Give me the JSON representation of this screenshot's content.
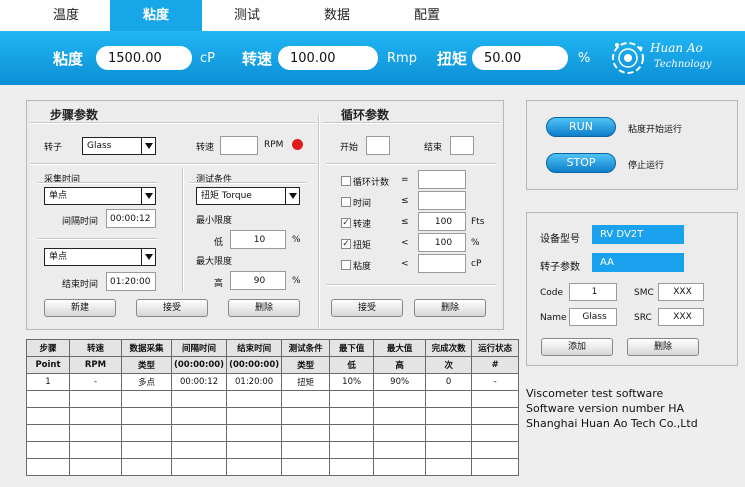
{
  "tabs": [
    {
      "label": "温度",
      "active": false
    },
    {
      "label": "粘度",
      "active": true
    },
    {
      "label": "测试",
      "active": false
    },
    {
      "label": "数据",
      "active": false
    },
    {
      "label": "配置",
      "active": false
    }
  ],
  "header": {
    "viscosity_label": "粘度",
    "viscosity_value": "1500.00",
    "viscosity_unit": "cP",
    "speed_label": "转速",
    "speed_value": "100.00",
    "speed_unit": "Rmp",
    "torque_label": "扭矩",
    "torque_value": "50.00",
    "torque_unit": "%",
    "logo_line1": "Huan Ao",
    "logo_line2": "Technology"
  },
  "step": {
    "title": "步骤参数",
    "rotor_label": "转子",
    "rotor_value": "Glass",
    "speed_label": "转速",
    "speed_value": "",
    "speed_unit": "RPM",
    "sampling_title": "采集时间",
    "sampling_mode_1": "单点",
    "interval_label": "间隔时间",
    "interval_value": "00:00:12",
    "sampling_mode_2": "单点",
    "end_label": "结束时间",
    "end_value": "01:20:00",
    "test_condition_label": "测试条件",
    "test_condition_value": "扭矩  Torque",
    "min_limit_label": "最小限度",
    "min_low_label": "低",
    "min_value": "10",
    "min_unit": "%",
    "max_limit_label": "最大限度",
    "max_high_label": "高",
    "max_value": "90",
    "max_unit": "%",
    "new_btn": "新建",
    "accept_btn": "接受",
    "delete_btn": "删除"
  },
  "loop": {
    "title": "循环参数",
    "start_label": "开始",
    "start_value": "",
    "end_label": "结束",
    "end_value": "",
    "rows": [
      {
        "label": "循环计数",
        "checked": false,
        "op": "=",
        "value": "",
        "unit": ""
      },
      {
        "label": "时间",
        "checked": false,
        "op": "≤",
        "value": "",
        "unit": ""
      },
      {
        "label": "转速",
        "checked": true,
        "op": "≤",
        "value": "100",
        "unit": "Fts"
      },
      {
        "label": "扭矩",
        "checked": true,
        "op": "<",
        "value": "100",
        "unit": "%"
      },
      {
        "label": "粘度",
        "checked": false,
        "op": "<",
        "value": "",
        "unit": "cP"
      }
    ],
    "accept_btn": "接受",
    "delete_btn": "删除"
  },
  "run": {
    "run_btn": "RUN",
    "run_desc": "粘度开始运行",
    "stop_btn": "STOP",
    "stop_desc": "停止运行"
  },
  "device": {
    "model_label": "设备型号",
    "model_value": "RV DV2T",
    "rotor_param_label": "转子参数",
    "rotor_param_value": "AA",
    "code_label": "Code",
    "code_value": "1",
    "smc_label": "SMC",
    "smc_value": "XXX",
    "name_label": "Name",
    "name_value": "Glass",
    "src_label": "SRC",
    "src_value": "XXX",
    "add_btn": "添加",
    "delete_btn": "删除"
  },
  "table": {
    "header1": [
      "步骤",
      "转速",
      "数据采集",
      "间隔时间",
      "结束时间",
      "测试条件",
      "最下值",
      "最大值",
      "完成次数",
      "运行状态"
    ],
    "header2": [
      "Point",
      "RPM",
      "类型",
      "(00:00:00)",
      "(00:00:00)",
      "类型",
      "低",
      "高",
      "次",
      "#"
    ],
    "rows": [
      [
        "1",
        "-",
        "多点",
        "00:00:12",
        "01:20:00",
        "扭矩",
        "10%",
        "90%",
        "0",
        "-"
      ]
    ],
    "empty_rows": 5
  },
  "info": {
    "line1": "Viscometer test software",
    "line2": "Software version number HA",
    "line3": "Shanghai Huan Ao Tech Co.,Ltd"
  },
  "colors": {
    "accent": "#17a6e8",
    "status_dot": "#e11c1c"
  }
}
